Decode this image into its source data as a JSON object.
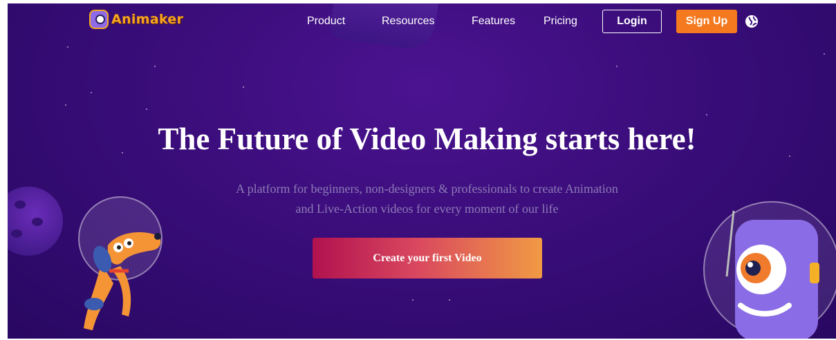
{
  "brand": {
    "name": "Animaker",
    "logo_icon": "animaker-mascot-icon",
    "accent": "#f7a51e"
  },
  "nav": {
    "links": [
      "Product",
      "Resources",
      "Features",
      "Pricing"
    ],
    "login_label": "Login",
    "signup_label": "Sign Up",
    "language_icon": "globe-icon"
  },
  "hero": {
    "title": "The Future of Video Making starts here!",
    "subtitle_line1": "A platform for beginners, non-designers & professionals to create Animation",
    "subtitle_line2": "and Live-Action videos for every moment of our life",
    "cta_label": "Create your first Video"
  },
  "colors": {
    "background": "#3a0d7a",
    "signup": "#f4791f",
    "cta_start": "#b1124f",
    "cta_end": "#f19a44",
    "subtitle": "#8d7bb6"
  }
}
